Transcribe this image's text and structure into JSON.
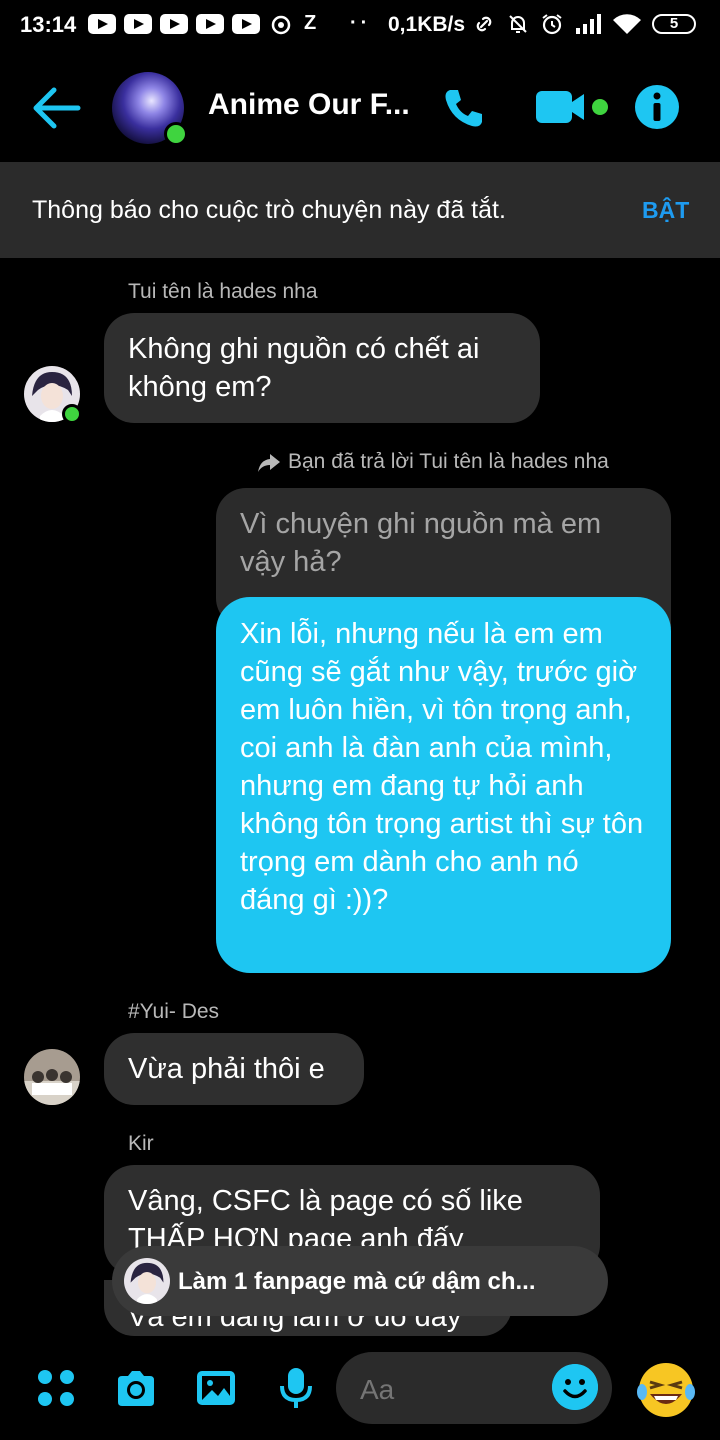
{
  "status_bar": {
    "time": "13:14",
    "misc_glyphs": "Z",
    "net_speed": "0,1KB/s",
    "battery": "5"
  },
  "header": {
    "title": "Anime Our F...",
    "back_icon": "back-arrow-icon",
    "call_icon": "phone-icon",
    "video_icon": "video-camera-icon",
    "info_icon": "info-icon"
  },
  "banner": {
    "text": "Thông báo cho cuộc trò chuyện này đã tắt.",
    "button": "BẬT"
  },
  "messages": [
    {
      "sender": "Tui tên là hades nha",
      "text": "Không ghi nguồn có chết ai không em?"
    },
    {
      "reply_note": "Bạn đã trả lời Tui tên là hades nha",
      "quoted": "Vì chuyện ghi nguồn mà em vậy hả?",
      "text": "Xin lỗi, nhưng nếu là em em cũng sẽ gắt như vậy, trước giờ em luôn hiền, vì tôn trọng anh, coi anh là đàn anh của mình, nhưng em đang tự hỏi anh không tôn trọng artist thì sự tôn trọng em dành cho anh nó đáng gì :))?"
    },
    {
      "sender": "#Yui- Des",
      "text": "Vừa phải thôi e"
    },
    {
      "sender": "Kir",
      "text": "Vâng, CSFC là page có số like THẤP HƠN page anh đấy",
      "text2": "Và em đang làm ở đó đấy"
    }
  ],
  "reply_pill": {
    "text": "Làm 1 fanpage mà cứ dậm ch..."
  },
  "composer": {
    "placeholder": "Aa"
  },
  "colors": {
    "accent": "#1ec6f2",
    "link": "#1e9bf0",
    "online": "#3fd43f"
  }
}
